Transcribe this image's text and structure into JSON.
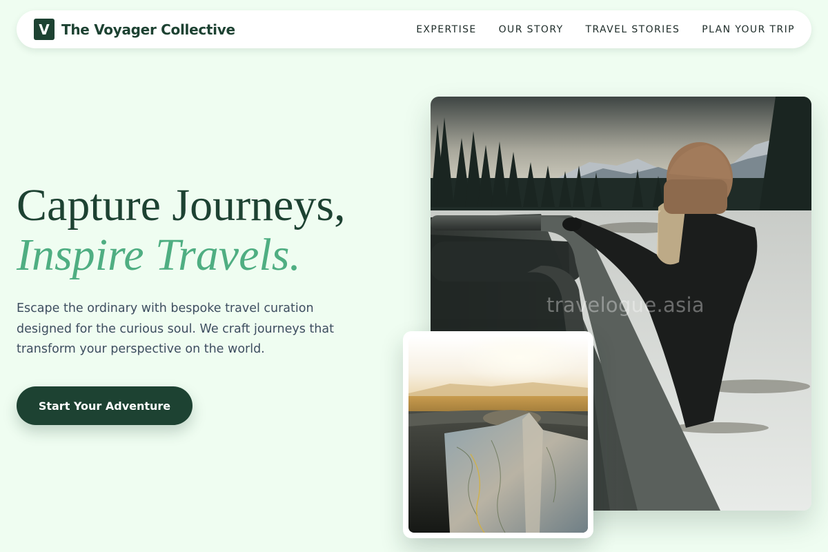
{
  "brand": {
    "logo_letter": "V",
    "name": "The Voyager Collective"
  },
  "nav": {
    "items": [
      {
        "label": "EXPERTISE"
      },
      {
        "label": "OUR STORY"
      },
      {
        "label": "TRAVEL STORIES"
      },
      {
        "label": "PLAN YOUR TRIP"
      }
    ]
  },
  "hero": {
    "title_line1": "Capture Journeys,",
    "title_line2": "Inspire Travels.",
    "description": "Escape the ordinary with bespoke travel curation designed for the curious soul. We craft journeys that transform your perspective on the world.",
    "cta_label": "Start Your Adventure"
  },
  "media": {
    "main_watermark": "travelogue.asia"
  },
  "colors": {
    "background": "#effdf1",
    "primary": "#1d4232",
    "accent": "#4fae82",
    "body_text": "#3e4e60"
  }
}
